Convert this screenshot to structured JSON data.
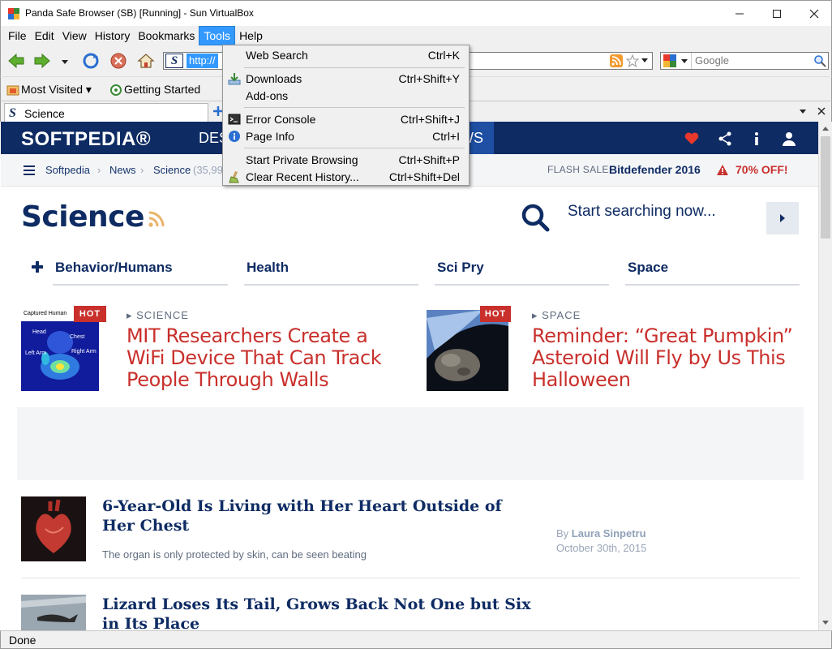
{
  "window": {
    "title": "Panda Safe Browser (SB) [Running] - Sun VirtualBox"
  },
  "menubar": {
    "items": [
      "File",
      "Edit",
      "View",
      "History",
      "Bookmarks",
      "Tools",
      "Help"
    ],
    "active": "Tools"
  },
  "navbar": {
    "url_text": "http://",
    "search_placeholder": "Google"
  },
  "bookmarks": {
    "most_visited": "Most Visited",
    "getting_started": "Getting Started"
  },
  "tabs": {
    "active_label": "Science"
  },
  "tools_menu": {
    "items": [
      {
        "label": "Web Search",
        "shortcut": "Ctrl+K",
        "icon": "none"
      },
      {
        "label": "Downloads",
        "shortcut": "Ctrl+Shift+Y",
        "icon": "download-icon"
      },
      {
        "label": "Add-ons",
        "shortcut": "",
        "icon": "none"
      },
      {
        "label": "Error Console",
        "shortcut": "Ctrl+Shift+J",
        "icon": "console-icon"
      },
      {
        "label": "Page Info",
        "shortcut": "Ctrl+I",
        "icon": "info-icon"
      },
      {
        "label": "Start Private Browsing",
        "shortcut": "Ctrl+Shift+P",
        "icon": "none"
      },
      {
        "label": "Clear Recent History...",
        "shortcut": "Ctrl+Shift+Del",
        "icon": "broom-icon"
      }
    ]
  },
  "site": {
    "logo": "SOFTPEDIA®",
    "nav_left_fragment": "DES",
    "nav_right_fragment": "WS",
    "breadcrumb": [
      "Softpedia",
      "News",
      "Science"
    ],
    "breadcrumb_count": "(35,99",
    "flash_label": "FLASH SALE:",
    "flash_deal": "Bitdefender 2016",
    "flash_off": "70% OFF!",
    "page_title": "Science",
    "search_hint": "Start searching now...",
    "categories": [
      "Behavior/Humans",
      "Health",
      "Sci Pry",
      "Space"
    ],
    "featured": [
      {
        "badge": "HOT",
        "kicker": "SCIENCE",
        "title": "MIT Researchers Create a WiFi Device That Can Track People Through Walls",
        "thumb_caption": "Captured Human",
        "thumb_labels": [
          "Head",
          "Chest",
          "Left Arm",
          "Right Arm"
        ]
      },
      {
        "badge": "HOT",
        "kicker": "SPACE",
        "title": "Reminder: “Great Pumpkin” Asteroid Will Fly by Us This Halloween"
      }
    ],
    "articles": [
      {
        "title": "6-Year-Old Is Living with Her Heart Outside of Her Chest",
        "desc": "The organ is only protected by skin, can be seen beating",
        "by": "By",
        "author": "Laura Sinpetru",
        "date": "October 30th, 2015"
      },
      {
        "title": "Lizard Loses Its Tail, Grows Back Not One but Six in Its Place",
        "desc": "",
        "by": "",
        "author": "",
        "date": ""
      }
    ]
  },
  "status": {
    "text": "Done"
  }
}
